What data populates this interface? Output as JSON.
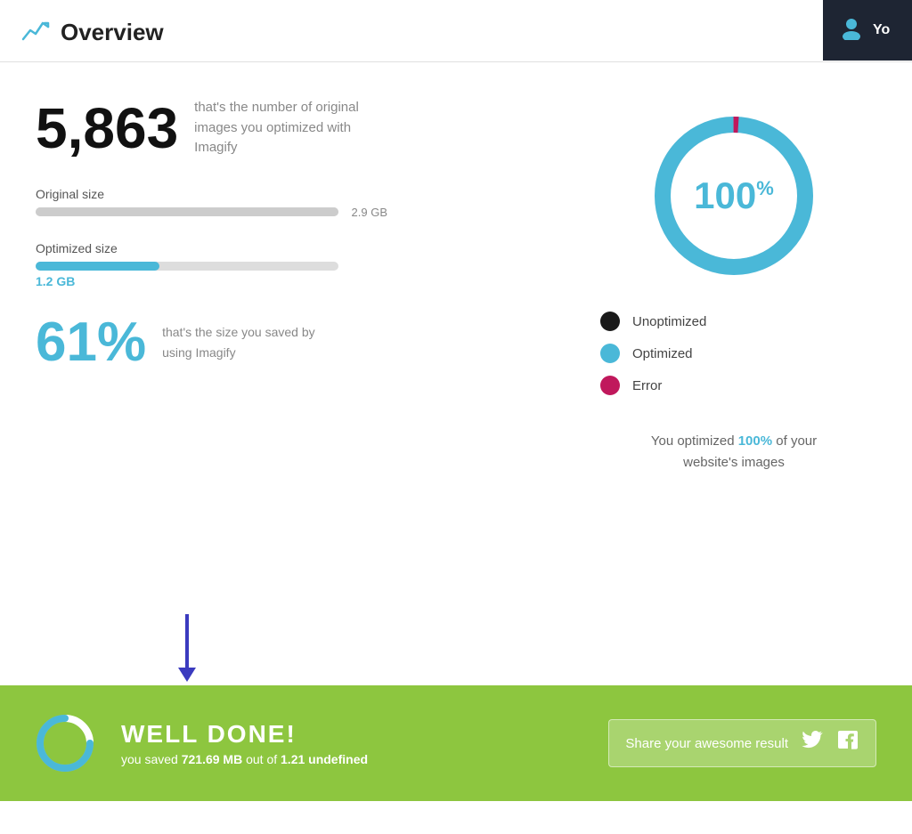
{
  "header": {
    "icon_label": "chart-icon",
    "title": "Overview",
    "user_label": "Yo"
  },
  "stats": {
    "image_count": "5,863",
    "image_count_desc": "that's the number of original images you optimized with Imagify",
    "original_size_label": "Original size",
    "original_size_value": "2.9 GB",
    "optimized_size_label": "Optimized size",
    "optimized_size_value": "1.2 GB",
    "optimized_bar_width_pct": 41,
    "savings_pct": "61%",
    "savings_desc": "that's the size you saved by using Imagify"
  },
  "donut": {
    "value": "100",
    "unit": "%",
    "summary": "You optimized 100% of your website's images",
    "summary_highlight": "100%"
  },
  "legend": [
    {
      "label": "Unoptimized",
      "color": "#1a1a1a"
    },
    {
      "label": "Optimized",
      "color": "#4ab8d8"
    },
    {
      "label": "Error",
      "color": "#c0185c"
    }
  ],
  "banner": {
    "title": "WELL DONE!",
    "sub_prefix": "you saved ",
    "sub_bold1": "721.69 MB",
    "sub_mid": " out of ",
    "sub_bold2": "1.21 undefined",
    "share_label": "Share your awesome result",
    "twitter_label": "twitter-icon",
    "facebook_label": "facebook-icon"
  }
}
